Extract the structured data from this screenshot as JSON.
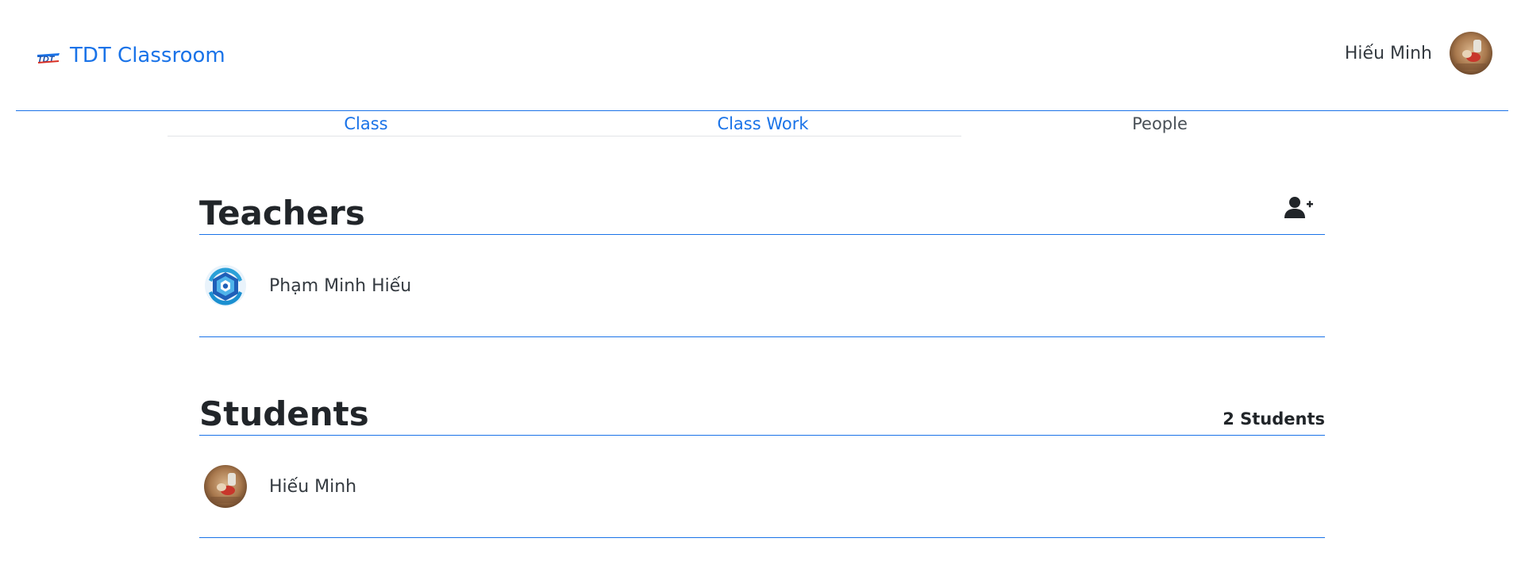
{
  "app": {
    "name": "TDT Classroom",
    "logo_text": "TDT"
  },
  "user": {
    "name": "Hiếu Minh"
  },
  "tabs": [
    {
      "label": "Class",
      "active": false
    },
    {
      "label": "Class Work",
      "active": false
    },
    {
      "label": "People",
      "active": true
    }
  ],
  "teachers": {
    "title": "Teachers",
    "action_icon": "add-person-icon",
    "people": [
      {
        "name": "Phạm Minh Hiếu",
        "avatar": "blue-emblem"
      }
    ]
  },
  "students": {
    "title": "Students",
    "count_label": "2 Students",
    "people": [
      {
        "name": "Hiếu Minh",
        "avatar": "photo"
      }
    ]
  },
  "colors": {
    "accent": "#1a73e8",
    "text": "#212529",
    "muted": "#495057"
  }
}
